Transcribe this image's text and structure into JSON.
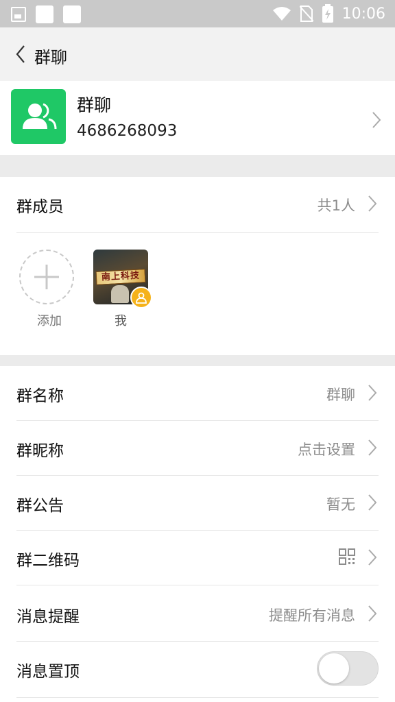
{
  "status_bar": {
    "time": "10:06",
    "icons": [
      "image-icon",
      "notification-square-icon",
      "notification-square-icon",
      "wifi-icon",
      "no-sim-icon",
      "battery-charging-icon"
    ]
  },
  "nav": {
    "title": "群聊",
    "back_icon": "chevron-left-icon"
  },
  "group": {
    "name": "群聊",
    "id": "4686268093",
    "avatar_icon": "group-users-icon"
  },
  "members_section": {
    "label": "群成员",
    "count": "共1人",
    "add_label": "添加",
    "members": [
      {
        "name": "我",
        "avatar_text": "南上科技",
        "badge_icon": "owner-badge-icon"
      }
    ]
  },
  "settings": {
    "group_name": {
      "label": "群名称",
      "value": "群聊"
    },
    "nickname": {
      "label": "群昵称",
      "value": "点击设置"
    },
    "notice": {
      "label": "群公告",
      "value": "暂无"
    },
    "qrcode": {
      "label": "群二维码",
      "icon": "qrcode-icon"
    },
    "reminder": {
      "label": "消息提醒",
      "value": "提醒所有消息"
    },
    "pin": {
      "label": "消息置顶",
      "enabled": false
    }
  },
  "colors": {
    "accent_green": "#1fc866",
    "badge_orange": "#f5b21a",
    "nav_bg": "#f2f2f2",
    "divider_bg": "#ebebeb"
  }
}
